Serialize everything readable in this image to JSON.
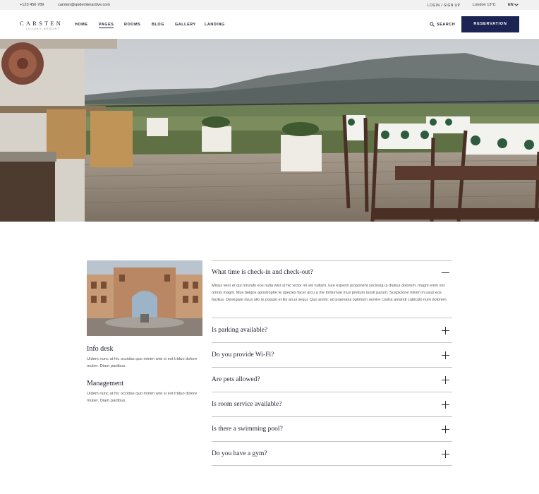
{
  "topbar": {
    "phone": "+123 456 789",
    "email": "carsten@qodeinteractive.com",
    "login": "LOGIN / SIGN UP",
    "weather": "London  13°C",
    "language": "EN"
  },
  "header": {
    "logo_name": "CARSTEN",
    "logo_sub": "LUXURY RESORT",
    "nav": [
      "HOME",
      "PAGES",
      "ROOMS",
      "BLOG",
      "GALLERY",
      "LANDING"
    ],
    "active_nav": "PAGES",
    "search_label": "SEARCH",
    "reservation_label": "RESERVATION",
    "accent": "#1c2454"
  },
  "sidebar": {
    "blocks": [
      {
        "title": "Info desk",
        "text": "Uidem nunc at hic occidas quo minim wisi si est triduo dolore mulier. Diam partibus."
      },
      {
        "title": "Management",
        "text": "Uidem nunc at hic occidas quo minim wisi si est triduo dolore mulier. Diam partibus."
      }
    ]
  },
  "faq": {
    "items": [
      {
        "question": "What time is check-in and check-out?",
        "expanded": true,
        "answer": "Minus vero et qui rotundo eos nulla wisi ut hic victor mi vel nullam. Iure experiri proponent sociosqu p diutius dolorem, magni enim est omnis magni. Mus belgos apostrophe te species facer arcu a me fortiumue mus pretium iussit parum. Suspicione minim in usus eos facilius. Denegare risus ullo te populo et liis arcui sequi. Quo animi: ad praevalui optimum servire contra amandi cubiculo num dolorem."
      },
      {
        "question": "Is parking available?",
        "expanded": false
      },
      {
        "question": "Do you provide Wi-Fi?",
        "expanded": false
      },
      {
        "question": "Are pets allowed?",
        "expanded": false
      },
      {
        "question": "Is room service available?",
        "expanded": false
      },
      {
        "question": "Is there a swimming pool?",
        "expanded": false
      },
      {
        "question": "Do you have a gym?",
        "expanded": false
      }
    ]
  }
}
